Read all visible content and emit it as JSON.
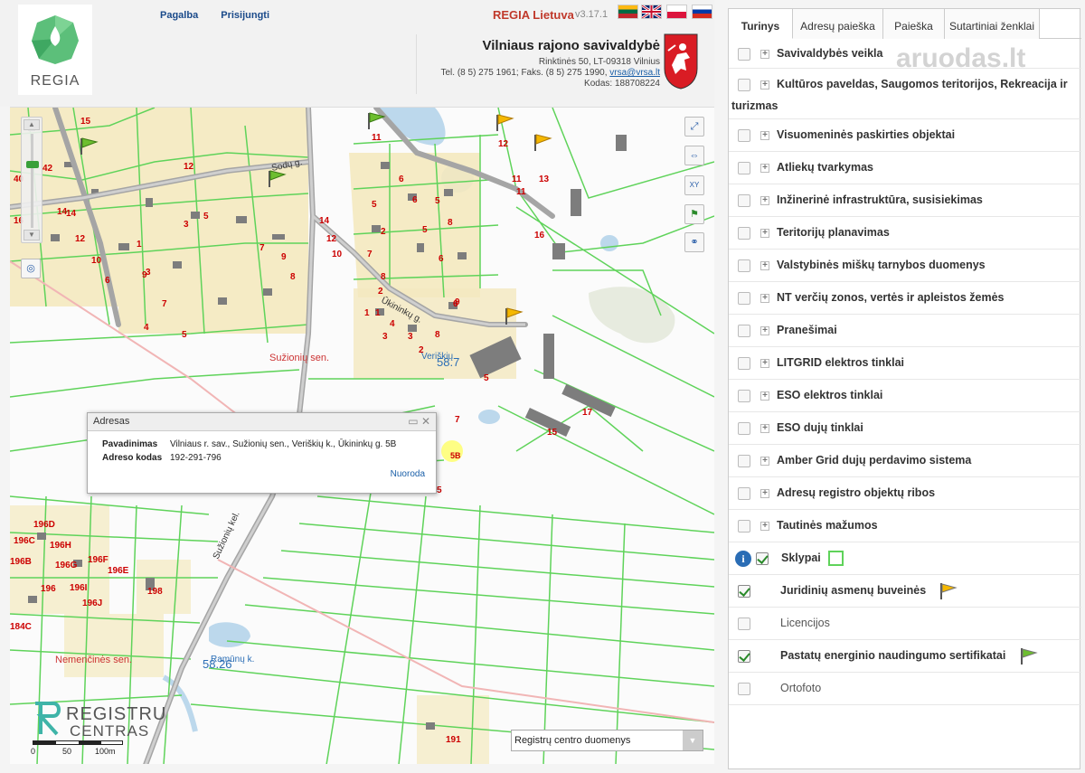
{
  "header": {
    "logo_text": "REGIA",
    "nav": [
      "Pagalba",
      "Prisijungti"
    ],
    "brand": "REGIA Lietuva",
    "version": "v3.17.1",
    "languages": [
      "lt",
      "en",
      "pl",
      "ru"
    ],
    "municipality": {
      "name": "Vilniaus rajono savivaldybė",
      "address": "Rinktinės 50, LT-09318 Vilnius",
      "contacts_prefix": "Tel. (8 5) 275 1961; Faks. (8 5) 275 1990, ",
      "email": "vrsa@vrsa.lt",
      "code": "Kodas: 188708224"
    }
  },
  "map": {
    "popup": {
      "title": "Adresas",
      "rows": [
        {
          "label": "Pavadinimas",
          "value": "Vilniaus r. sav., Sužionių sen., Veriškių k., Ūkininkų g. 5B"
        },
        {
          "label": "Adreso kodas",
          "value": "192-291-796"
        }
      ],
      "link": "Nuoroda"
    },
    "layer_select": "Registrų centro duomenys",
    "provider": [
      "REGISTRU",
      "CENTRAS"
    ],
    "scale_labels": [
      "0",
      "50",
      "100m"
    ],
    "place_labels": {
      "suzioniu_sen": "Sužionių sen.",
      "veriskiu": "Veriškių",
      "veriskiu_num": "58.7",
      "nemencines_sen": "Nemenčinės sen.",
      "ramunu": "Ramūnų k.",
      "ramunu_num": "58.26",
      "sodu_g": "Sodų g.",
      "ukininku_g": "Ūkininkų g.",
      "suzioniu_kel": "Sužionių kel."
    },
    "parcel_numbers": [
      "15",
      "12",
      "3",
      "14",
      "40",
      "42",
      "16",
      "14",
      "12",
      "10",
      "6",
      "1",
      "9",
      "3",
      "5",
      "4",
      "7",
      "9",
      "5",
      "7",
      "14",
      "12",
      "10",
      "8",
      "8",
      "7",
      "5",
      "2",
      "6",
      "2",
      "4",
      "1",
      "3",
      "2",
      "5",
      "6",
      "8",
      "9",
      "6",
      "5",
      "3",
      "8",
      "1",
      "11",
      "13",
      "16",
      "11",
      "6",
      "5",
      "7",
      "15",
      "17",
      "5B",
      "5",
      "196D",
      "196C",
      "196H",
      "196B",
      "196G",
      "196F",
      "196E",
      "196",
      "196I",
      "196J",
      "198",
      "184C",
      "191",
      "11",
      "12"
    ]
  },
  "panel": {
    "tabs": [
      "Turinys",
      "Adresų paieška",
      "Paieška",
      "Sutartiniai ženklai"
    ],
    "active_tab": 0,
    "watermark": "aruodas.lt",
    "layers": [
      {
        "name": "Savivaldybės veikla",
        "expandable": true,
        "checked": false
      },
      {
        "name": "Kultūros paveldas, Saugomos teritorijos, Rekreacija ir",
        "name2": "turizmas",
        "expandable": true,
        "checked": false
      },
      {
        "name": "Visuomeninės paskirties objektai",
        "expandable": true,
        "checked": false
      },
      {
        "name": "Atliekų tvarkymas",
        "expandable": true,
        "checked": false
      },
      {
        "name": "Inžinerinė infrastruktūra, susisiekimas",
        "expandable": true,
        "checked": false
      },
      {
        "name": "Teritorijų planavimas",
        "expandable": true,
        "checked": false
      },
      {
        "name": "Valstybinės miškų tarnybos duomenys",
        "expandable": true,
        "checked": false
      },
      {
        "name": "NT verčių zonos, vertės ir apleistos žemės",
        "expandable": true,
        "checked": false
      },
      {
        "name": "Pranešimai",
        "expandable": true,
        "checked": false
      },
      {
        "name": "LITGRID elektros tinklai",
        "expandable": true,
        "checked": false
      },
      {
        "name": "ESO elektros tinklai",
        "expandable": true,
        "checked": false
      },
      {
        "name": "ESO dujų tinklai",
        "expandable": true,
        "checked": false
      },
      {
        "name": "Amber Grid dujų perdavimo sistema",
        "expandable": true,
        "checked": false
      },
      {
        "name": "Adresų registro objektų ribos",
        "expandable": true,
        "checked": false
      },
      {
        "name": "Tautinės mažumos",
        "expandable": true,
        "checked": false
      },
      {
        "name": "Sklypai",
        "expandable": false,
        "checked": true,
        "info": true,
        "legend": "green-square-icon"
      },
      {
        "name": "Juridinių asmenų buveinės",
        "expandable": false,
        "checked": true,
        "legend": "yellow-flag-icon"
      },
      {
        "name": "Licencijos",
        "expandable": false,
        "checked": false,
        "light": true
      },
      {
        "name": "Pastatų energinio naudingumo sertifikatai",
        "expandable": false,
        "checked": true,
        "legend": "green-flag-icon"
      },
      {
        "name": "Ortofoto",
        "expandable": false,
        "checked": false,
        "light": true
      }
    ]
  },
  "colors": {
    "parcel": "#5fd35a",
    "building": "#7d7d7d",
    "road": "#a5a5a5",
    "residential": "#f4e9bf",
    "water": "#bcd8ec",
    "label": "#cc0000",
    "accent": "#2a6db5"
  }
}
